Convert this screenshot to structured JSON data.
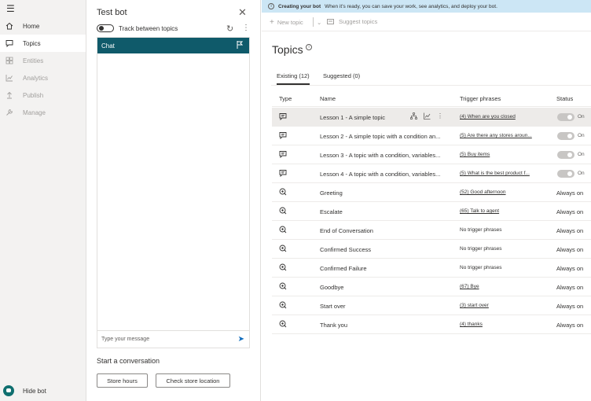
{
  "nav": {
    "items": [
      {
        "label": "Home",
        "icon": "home-icon",
        "state": "normal"
      },
      {
        "label": "Topics",
        "icon": "chat-icon",
        "state": "active"
      },
      {
        "label": "Entities",
        "icon": "grid-icon",
        "state": "disabled"
      },
      {
        "label": "Analytics",
        "icon": "chart-icon",
        "state": "disabled"
      },
      {
        "label": "Publish",
        "icon": "upload-icon",
        "state": "disabled"
      },
      {
        "label": "Manage",
        "icon": "wrench-icon",
        "state": "disabled"
      }
    ],
    "hide_bot_label": "Hide bot"
  },
  "test_panel": {
    "title": "Test bot",
    "track_label": "Track between topics",
    "chat_header": "Chat",
    "input_placeholder": "Type your message",
    "start_title": "Start a conversation",
    "buttons": [
      "Store hours",
      "Check store location"
    ]
  },
  "main": {
    "banner": {
      "title": "Creating your bot",
      "text": "When it's ready, you can save your work, see analytics, and deploy your bot."
    },
    "commands": {
      "new_topic": "New topic",
      "suggest_topics": "Suggest topics"
    },
    "page_title": "Topics",
    "tabs": [
      "Existing (12)",
      "Suggested (0)"
    ],
    "columns": [
      "Type",
      "Name",
      "Trigger phrases",
      "Status"
    ],
    "rows": [
      {
        "name": "Lesson 1 - A simple topic",
        "trigger": "(4) When are you closed",
        "status": "On",
        "kind": "custom"
      },
      {
        "name": "Lesson 2 - A simple topic with a condition an...",
        "trigger": "(5) Are there any stores aroun...",
        "status": "On",
        "kind": "custom"
      },
      {
        "name": "Lesson 3 - A topic with a condition, variables...",
        "trigger": "(5) Buy items",
        "status": "On",
        "kind": "custom"
      },
      {
        "name": "Lesson 4 - A topic with a condition, variables...",
        "trigger": "(5) What is the best product f...",
        "status": "On",
        "kind": "custom"
      },
      {
        "name": "Greeting",
        "trigger": "(52) Good afternoon",
        "status": "Always on",
        "kind": "system"
      },
      {
        "name": "Escalate",
        "trigger": "(65) Talk to agent",
        "status": "Always on",
        "kind": "system"
      },
      {
        "name": "End of Conversation",
        "trigger": "No trigger phrases",
        "status": "Always on",
        "kind": "system"
      },
      {
        "name": "Confirmed Success",
        "trigger": "No trigger phrases",
        "status": "Always on",
        "kind": "system"
      },
      {
        "name": "Confirmed Failure",
        "trigger": "No trigger phrases",
        "status": "Always on",
        "kind": "system"
      },
      {
        "name": "Goodbye",
        "trigger": "(67) Bye",
        "status": "Always on",
        "kind": "system"
      },
      {
        "name": "Start over",
        "trigger": "(3) start over",
        "status": "Always on",
        "kind": "system"
      },
      {
        "name": "Thank you",
        "trigger": "(4) thanks",
        "status": "Always on",
        "kind": "system"
      }
    ]
  },
  "colors": {
    "accent": "#0f5a6a",
    "banner": "#cce6f5",
    "nav_bg": "#f3f2f1"
  }
}
